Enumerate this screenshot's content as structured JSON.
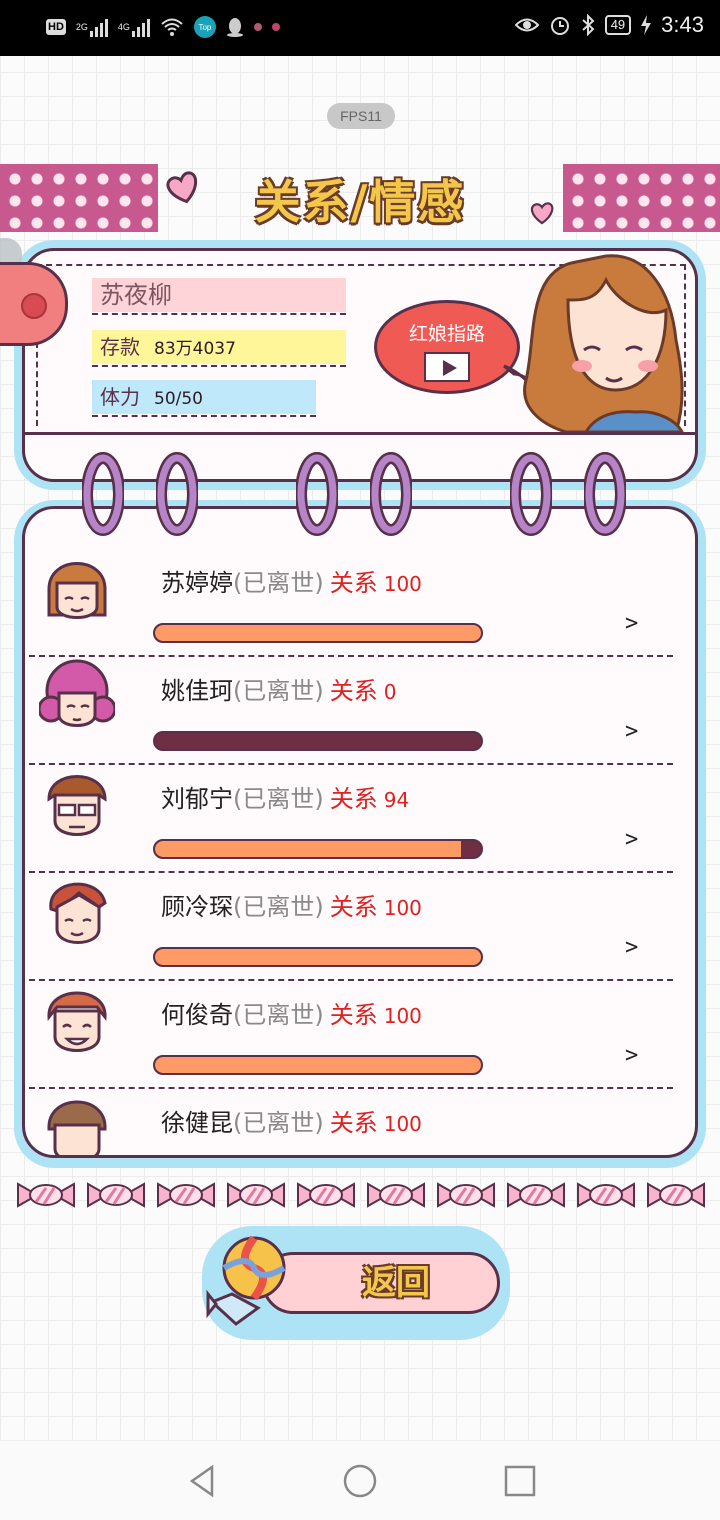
{
  "status_bar": {
    "left_items": [
      "HD",
      "2G",
      "4G",
      "wifi",
      "Top",
      "qq",
      "dot",
      "dot"
    ],
    "hd": "HD",
    "net1": "2G",
    "net2": "4G",
    "top_badge": "Top",
    "battery": "49",
    "time": "3:43",
    "icons": [
      "eye-icon",
      "alarm-icon",
      "bluetooth-icon",
      "battery-icon",
      "charging-icon"
    ]
  },
  "fps": "FPS11",
  "title": "关系/情感",
  "profile": {
    "name": "苏夜柳",
    "money_label": "存款",
    "money_value": "83万4037",
    "stamina_label": "体力",
    "stamina_value": "50/50",
    "matchmaker_label": "红娘指路"
  },
  "relations": [
    {
      "name": "苏婷婷",
      "status": "(已离世)",
      "rel_label": "关系",
      "value": "100",
      "level": 100,
      "avatar": "girl-bob-avatar"
    },
    {
      "name": "姚佳珂",
      "status": "(已离世)",
      "rel_label": "关系",
      "value": "0",
      "level": 0,
      "avatar": "girl-curly-avatar"
    },
    {
      "name": "刘郁宁",
      "status": "(已离世)",
      "rel_label": "关系",
      "value": "94",
      "level": 94,
      "avatar": "boy-glasses-avatar"
    },
    {
      "name": "顾冷琛",
      "status": "(已离世)",
      "rel_label": "关系",
      "value": "100",
      "level": 100,
      "avatar": "boy-redhair-avatar"
    },
    {
      "name": "何俊奇",
      "status": "(已离世)",
      "rel_label": "关系",
      "value": "100",
      "level": 100,
      "avatar": "boy-smile-avatar"
    },
    {
      "name": "徐健昆",
      "status": "(已离世)",
      "rel_label": "关系",
      "value": "100",
      "level": 100,
      "avatar": "boy-brown-avatar"
    }
  ],
  "chevron": ">",
  "back_label": "返回",
  "colors": {
    "accent_pink": "#c8598e",
    "sky_blue": "#aee3f5",
    "bar_fill": "#fe9a66",
    "bar_empty": "#6e2e44",
    "relation_red": "#e02020",
    "title_yellow": "#f3c84a"
  },
  "nav": [
    "back-triangle-icon",
    "home-circle-icon",
    "recents-square-icon"
  ]
}
